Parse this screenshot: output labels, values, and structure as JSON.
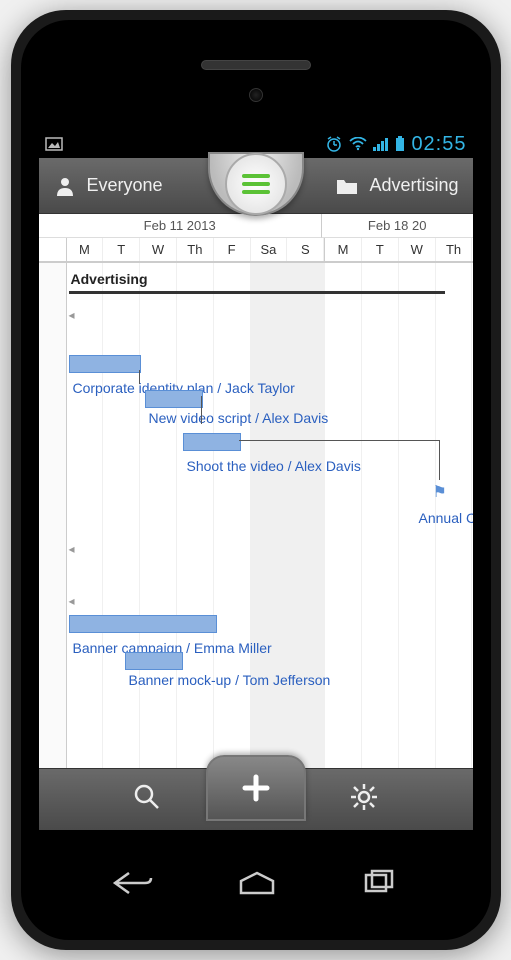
{
  "status": {
    "time": "02:55"
  },
  "header": {
    "left_label": "Everyone",
    "right_label": "Advertising"
  },
  "weeks": {
    "w1": "Feb 11 2013",
    "w2": "Feb 18 20"
  },
  "days": [
    "M",
    "T",
    "W",
    "Th",
    "F",
    "Sa",
    "S",
    "M",
    "T",
    "W",
    "Th"
  ],
  "section": {
    "title": "Advertising"
  },
  "tasks": {
    "t1_label": "Corporate identity plan / Jack Taylor",
    "t2_label": "New video script / Alex Davis",
    "t3_label": "Shoot the video / Alex Davis",
    "t4_label": "Annual Con",
    "t5_label": "Banner campaign / Emma Miller",
    "t6_label": "Banner mock-up / Tom Jefferson"
  }
}
